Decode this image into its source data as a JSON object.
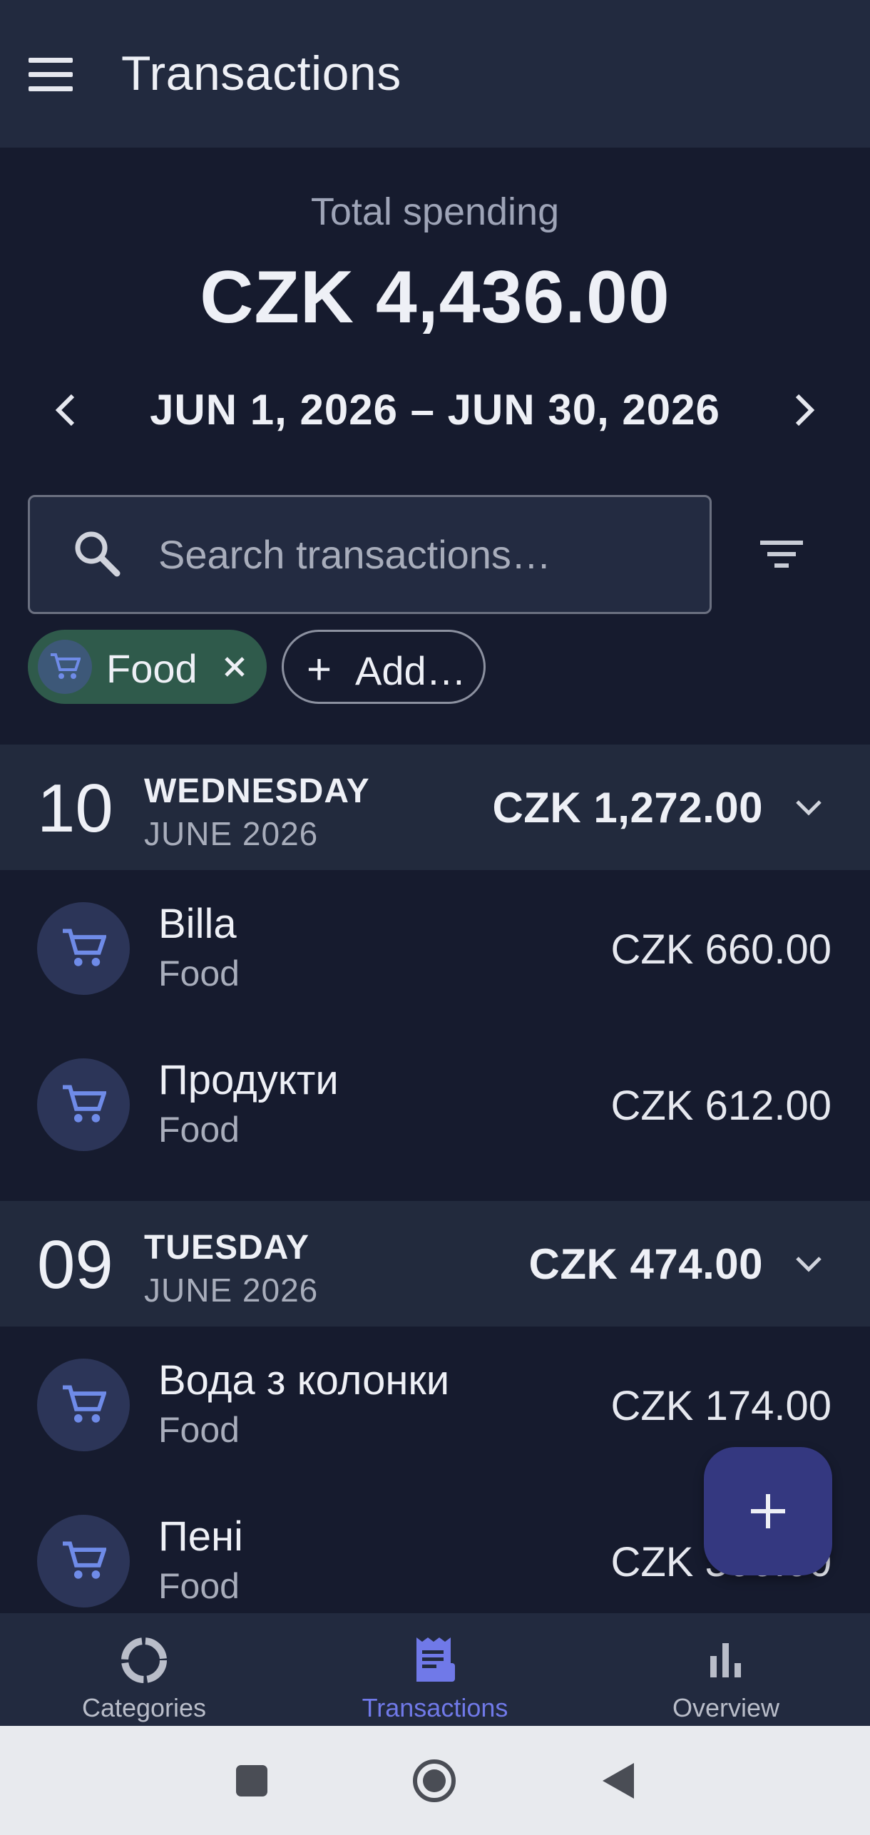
{
  "appbar": {
    "title": "Transactions",
    "menu_icon": "hamburger-menu-icon"
  },
  "summary": {
    "label": "Total spending",
    "total": "CZK 4,436.00"
  },
  "range": {
    "text": "JUN 1, 2026 – JUN 30, 2026"
  },
  "search": {
    "placeholder": "Search transactions…",
    "value": ""
  },
  "chips": {
    "food_label": "Food",
    "add_label": "Add…"
  },
  "days": [
    {
      "day": "10",
      "weekday": "WEDNESDAY",
      "month": "JUNE 2026",
      "total": "CZK 1,272.00",
      "transactions": [
        {
          "name": "Billa",
          "category": "Food",
          "amount": "CZK 660.00"
        },
        {
          "name": "Продукти",
          "category": "Food",
          "amount": "CZK 612.00"
        }
      ]
    },
    {
      "day": "09",
      "weekday": "TUESDAY",
      "month": "JUNE 2026",
      "total": "CZK 474.00",
      "transactions": [
        {
          "name": "Вода з колонки",
          "category": "Food",
          "amount": "CZK 174.00"
        },
        {
          "name": "Пені",
          "category": "Food",
          "amount": "CZK 300.00"
        }
      ]
    }
  ],
  "bottom_nav": {
    "items": [
      {
        "label": "Categories",
        "icon": "donut-chart-icon"
      },
      {
        "label": "Transactions",
        "icon": "receipt-icon",
        "active": true
      },
      {
        "label": "Overview",
        "icon": "bar-chart-icon"
      }
    ]
  },
  "colors": {
    "background": "#161b2e",
    "appbar": "#222a3f",
    "accent": "#7079e8",
    "food_chip": "#2f5a4b",
    "fab": "#343880"
  }
}
